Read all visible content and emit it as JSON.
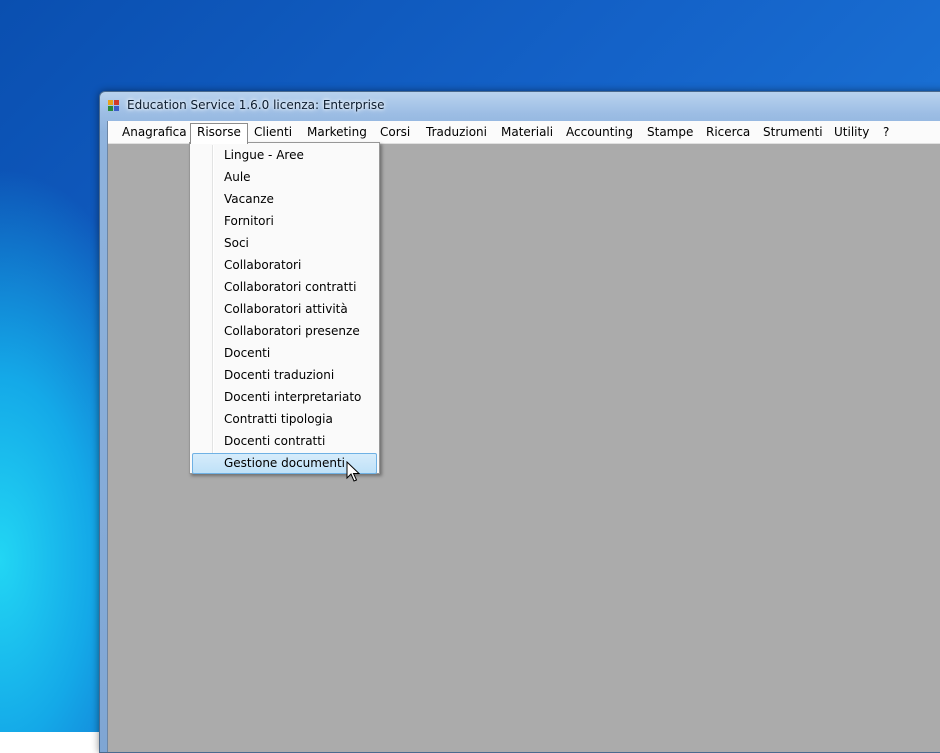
{
  "window": {
    "title": "Education Service 1.6.0 licenza: Enterprise"
  },
  "menubar": {
    "items": [
      {
        "label": "Anagrafica"
      },
      {
        "label": "Risorse",
        "open": true
      },
      {
        "label": "Clienti"
      },
      {
        "label": "Marketing"
      },
      {
        "label": "Corsi"
      },
      {
        "label": "Traduzioni"
      },
      {
        "label": "Materiali"
      },
      {
        "label": "Accounting"
      },
      {
        "label": "Stampe"
      },
      {
        "label": "Ricerca"
      },
      {
        "label": "Strumenti"
      },
      {
        "label": "Utility"
      },
      {
        "label": "?"
      }
    ]
  },
  "risorse_menu": {
    "items": [
      {
        "label": "Lingue - Aree"
      },
      {
        "label": "Aule"
      },
      {
        "label": "Vacanze"
      },
      {
        "label": "Fornitori"
      },
      {
        "label": "Soci"
      },
      {
        "label": "Collaboratori"
      },
      {
        "label": "Collaboratori contratti"
      },
      {
        "label": "Collaboratori attività"
      },
      {
        "label": "Collaboratori presenze"
      },
      {
        "label": "Docenti"
      },
      {
        "label": "Docenti traduzioni"
      },
      {
        "label": "Docenti interpretariato"
      },
      {
        "label": "Contratti tipologia"
      },
      {
        "label": "Docenti contratti"
      },
      {
        "label": "Gestione documenti",
        "highlighted": true
      }
    ]
  },
  "colors": {
    "client_background": "#ababab",
    "menu_highlight": "#bfe1f8",
    "menu_highlight_border": "#6fb1e4"
  },
  "icons": {
    "app": "app-icon",
    "pointer": "mouse-pointer-icon"
  }
}
